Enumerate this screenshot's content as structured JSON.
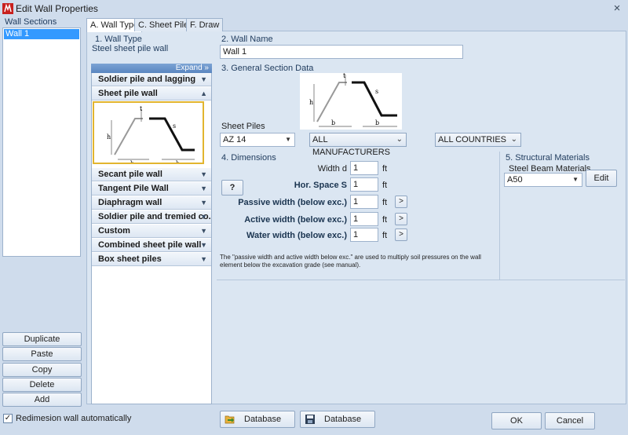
{
  "window": {
    "title": "Edit Wall Properties",
    "close_glyph": "×"
  },
  "sidebar": {
    "label": "Wall Sections",
    "items": [
      "Wall 1"
    ],
    "buttons": [
      "Duplicate",
      "Paste",
      "Copy",
      "Delete",
      "Add"
    ]
  },
  "tabs": [
    "A. Wall Type",
    "C. Sheet Piles",
    "F. Draw"
  ],
  "wall_type": {
    "section_label": "1. Wall Type",
    "value": "Steel sheet pile wall",
    "expand_label": "Expand »",
    "items": [
      "Soldier pile and lagging",
      "Sheet pile wall",
      "Secant pile wall",
      "Tangent Pile Wall",
      "Diaphragm wall",
      "Soldier pile and tremied co...",
      "Custom",
      "Combined sheet pile wall",
      "Box sheet piles"
    ],
    "selected_item": "Sheet pile wall"
  },
  "wall_name": {
    "section_label": "2. Wall Name",
    "value": "Wall 1"
  },
  "general_section": {
    "section_label": "3. General Section Data",
    "sheet_piles_label": "Sheet Piles",
    "sheet_pile_value": "AZ 14",
    "manufacturer_value": "ALL MANUFACTURERS",
    "country_value": "ALL COUNTRIES"
  },
  "dimensions": {
    "section_label": "4. Dimensions",
    "help_label": "?",
    "rows": [
      {
        "label": "Width d",
        "value": "1",
        "unit": "ft",
        "bold": false,
        "has_button": false
      },
      {
        "label": "Hor. Space S",
        "value": "1",
        "unit": "ft",
        "bold": true,
        "has_button": false
      },
      {
        "label": "Passive width (below exc.)",
        "value": "1",
        "unit": "ft",
        "bold": true,
        "has_button": true
      },
      {
        "label": "Active width (below exc.)",
        "value": "1",
        "unit": "ft",
        "bold": true,
        "has_button": true
      },
      {
        "label": "Water width (below exc.)",
        "value": "1",
        "unit": "ft",
        "bold": true,
        "has_button": true
      }
    ],
    "arrow_label": ">",
    "note": "The \"passive width and active width below exc.\" are used to multiply soil pressures on the wall element below the excavation grade (see manual)."
  },
  "materials": {
    "section_label": "5. Structural Materials",
    "steel_label": "Steel Beam Materials",
    "steel_value": "A50",
    "edit_label": "Edit"
  },
  "drawing": {
    "dim_b": "b",
    "dim_t": "t",
    "dim_h": "h",
    "dim_s": "s"
  },
  "footer": {
    "redimension_checked": "✓",
    "redimension_label": "Redimesion wall automatically",
    "database_left": "Database",
    "database_right": "Database",
    "ok": "OK",
    "cancel": "Cancel"
  },
  "colors": {
    "accent": "#3399ff",
    "highlight_border": "#e2b52f",
    "panel_bg": "#dbe6f2"
  }
}
